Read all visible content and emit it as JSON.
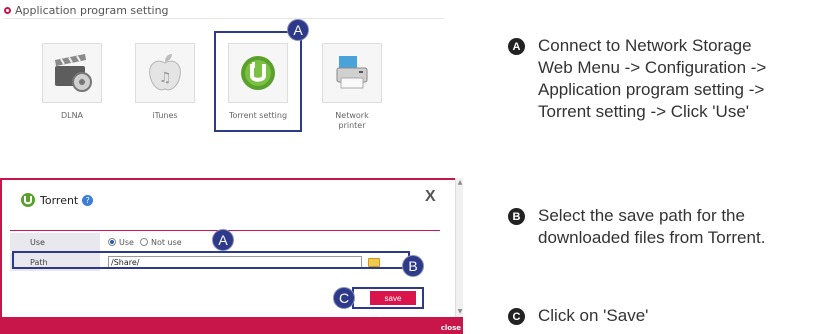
{
  "app_settings": {
    "header": "Application program setting",
    "apps": [
      {
        "label": "DLNA"
      },
      {
        "label": "iTunes"
      },
      {
        "label": "Torrent setting"
      },
      {
        "label": "Network\nprinter"
      }
    ],
    "marker": "A"
  },
  "torrent_dialog": {
    "title": "Torrent",
    "close": "X",
    "use_label": "Use",
    "use_option": "Use",
    "not_use_option": "Not use",
    "path_label": "Path",
    "path_value": "/Share/",
    "save_label": "save",
    "footer_text": "close",
    "markers": {
      "a": "A",
      "b": "B",
      "c": "C"
    }
  },
  "instructions": [
    {
      "badge": "A",
      "text": "Connect to Network Storage\nWeb Menu -> Configuration ->\nApplication program setting ->\nTorrent setting -> Click 'Use'"
    },
    {
      "badge": "B",
      "text": "Select the save path for the\ndownloaded files from Torrent."
    },
    {
      "badge": "C",
      "text": "Click on 'Save'"
    }
  ],
  "colors": {
    "accent": "#c8164a",
    "highlight": "#2d3a8a",
    "button": "#d9154b"
  }
}
